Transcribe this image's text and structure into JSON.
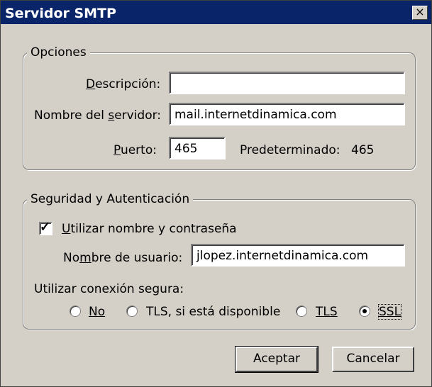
{
  "window": {
    "title": "Servidor SMTP",
    "close_glyph": "×"
  },
  "options": {
    "legend": "Opciones",
    "description": {
      "label": "Descripción:",
      "value": ""
    },
    "server": {
      "label": "Nombre del servidor:",
      "value": "mail.internetdinamica.com"
    },
    "port": {
      "label": "Puerto:",
      "value": "465",
      "default_label": "Predeterminado:",
      "default_value": "465"
    }
  },
  "security": {
    "legend": "Seguridad y Autenticación",
    "use_credentials": {
      "label": "Utilizar nombre y contraseña",
      "checked": true
    },
    "username": {
      "label": "Nombre de usuario:",
      "value": "jlopez.internetdinamica.com"
    },
    "secure_label": "Utilizar conexión segura:",
    "radios": [
      {
        "label": "No",
        "selected": false
      },
      {
        "label": "TLS, si está disponible",
        "selected": false
      },
      {
        "label": "TLS",
        "selected": false
      },
      {
        "label": "SSL",
        "selected": true
      }
    ]
  },
  "buttons": {
    "ok": "Aceptar",
    "cancel": "Cancelar"
  }
}
